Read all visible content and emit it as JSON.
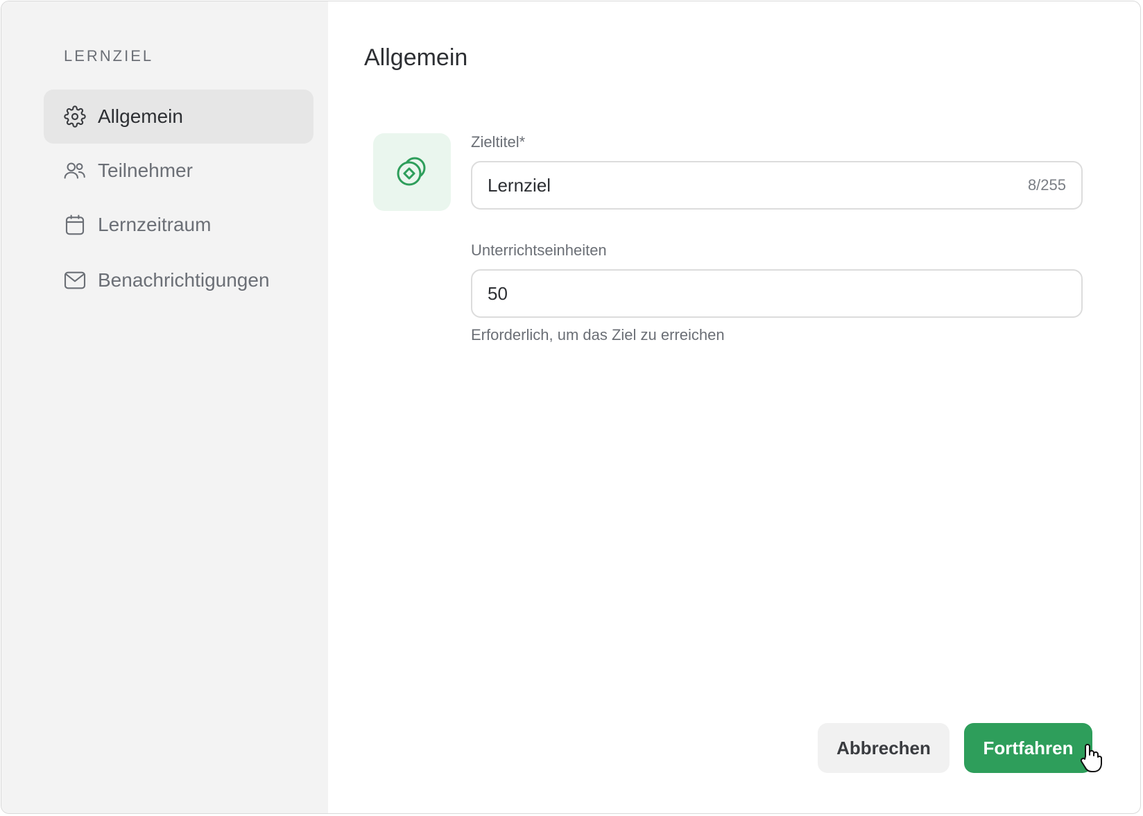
{
  "sidebar": {
    "heading": "LERNZIEL",
    "items": [
      {
        "label": "Allgemein",
        "icon": "gear-icon",
        "active": true
      },
      {
        "label": "Teilnehmer",
        "icon": "users-icon",
        "active": false
      },
      {
        "label": "Lernzeitraum",
        "icon": "calendar-icon",
        "active": false
      },
      {
        "label": "Benachrichtigungen",
        "icon": "mail-icon",
        "active": false
      }
    ]
  },
  "main": {
    "title": "Allgemein",
    "goal_icon": "goal-target-icon",
    "fields": {
      "title_field": {
        "label": "Zieltitel*",
        "value": "Lernziel",
        "counter": "8/255"
      },
      "units_field": {
        "label": "Unterrichtseinheiten",
        "value": "50",
        "helper": "Erforderlich, um das Ziel zu erreichen"
      }
    }
  },
  "footer": {
    "cancel_label": "Abbrechen",
    "continue_label": "Fortfahren"
  },
  "colors": {
    "accent": "#2e9e5b",
    "accent_light": "#eaf6ee",
    "sidebar_bg": "#f3f3f3",
    "active_item_bg": "#e6e6e6"
  }
}
